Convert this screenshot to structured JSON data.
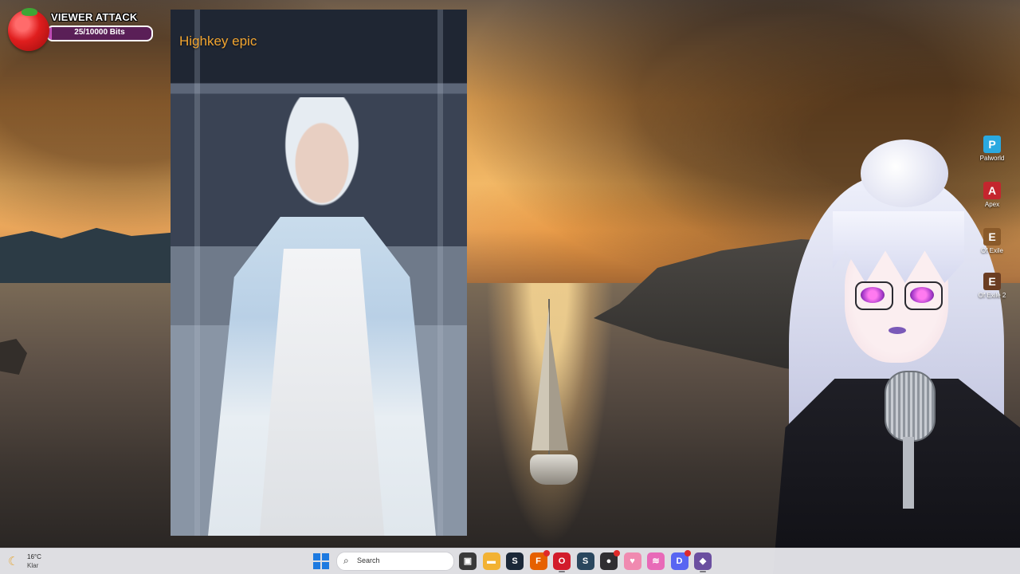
{
  "viewer_attack": {
    "title": "VIEWER ATTACK",
    "progress_text": "25/10000 Bits",
    "progress_fraction": 0.0025,
    "accent_color": "#c94fbf"
  },
  "image_window": {
    "caption": "Highkey epic",
    "caption_color": "#f2a530"
  },
  "desktop_icons": [
    {
      "label": "Palworld",
      "icon": "palworld-icon",
      "color": "#2aa9e0",
      "glyph": "P"
    },
    {
      "label": "Apex",
      "icon": "apex-icon",
      "color": "#c4262e",
      "glyph": "A"
    },
    {
      "label": "Of Exile",
      "icon": "path-of-exile-icon",
      "color": "#8a5a2a",
      "glyph": "E"
    },
    {
      "label": "Of Exile 2",
      "icon": "path-of-exile-2-icon",
      "color": "#6b3d22",
      "glyph": "E"
    }
  ],
  "taskbar": {
    "weather": {
      "temperature": "16°C",
      "condition": "Klar",
      "icon": "moon-icon"
    },
    "search_placeholder": "Search",
    "apps": [
      {
        "name": "task-view-icon",
        "glyph": "▣",
        "color": "#3a3a3a",
        "badge": false
      },
      {
        "name": "file-explorer-icon",
        "glyph": "▬",
        "color": "#f2b233",
        "badge": false
      },
      {
        "name": "steam-icon",
        "glyph": "S",
        "color": "#1b2838",
        "badge": false
      },
      {
        "name": "firefox-icon",
        "glyph": "F",
        "color": "#e66000",
        "badge": true
      },
      {
        "name": "opera-icon",
        "glyph": "O",
        "color": "#d21c2b",
        "badge": false
      },
      {
        "name": "steam-icon-2",
        "glyph": "S",
        "color": "#2a475e",
        "badge": false
      },
      {
        "name": "obs-icon",
        "glyph": "●",
        "color": "#302e31",
        "badge": true
      },
      {
        "name": "heart-app-icon",
        "glyph": "♥",
        "color": "#f08ab0",
        "badge": false
      },
      {
        "name": "stream-app-icon",
        "glyph": "≋",
        "color": "#e86ab8",
        "badge": false
      },
      {
        "name": "discord-icon",
        "glyph": "D",
        "color": "#5865f2",
        "badge": true
      },
      {
        "name": "vtuber-app-icon",
        "glyph": "◆",
        "color": "#6b4fa0",
        "badge": false
      }
    ]
  }
}
